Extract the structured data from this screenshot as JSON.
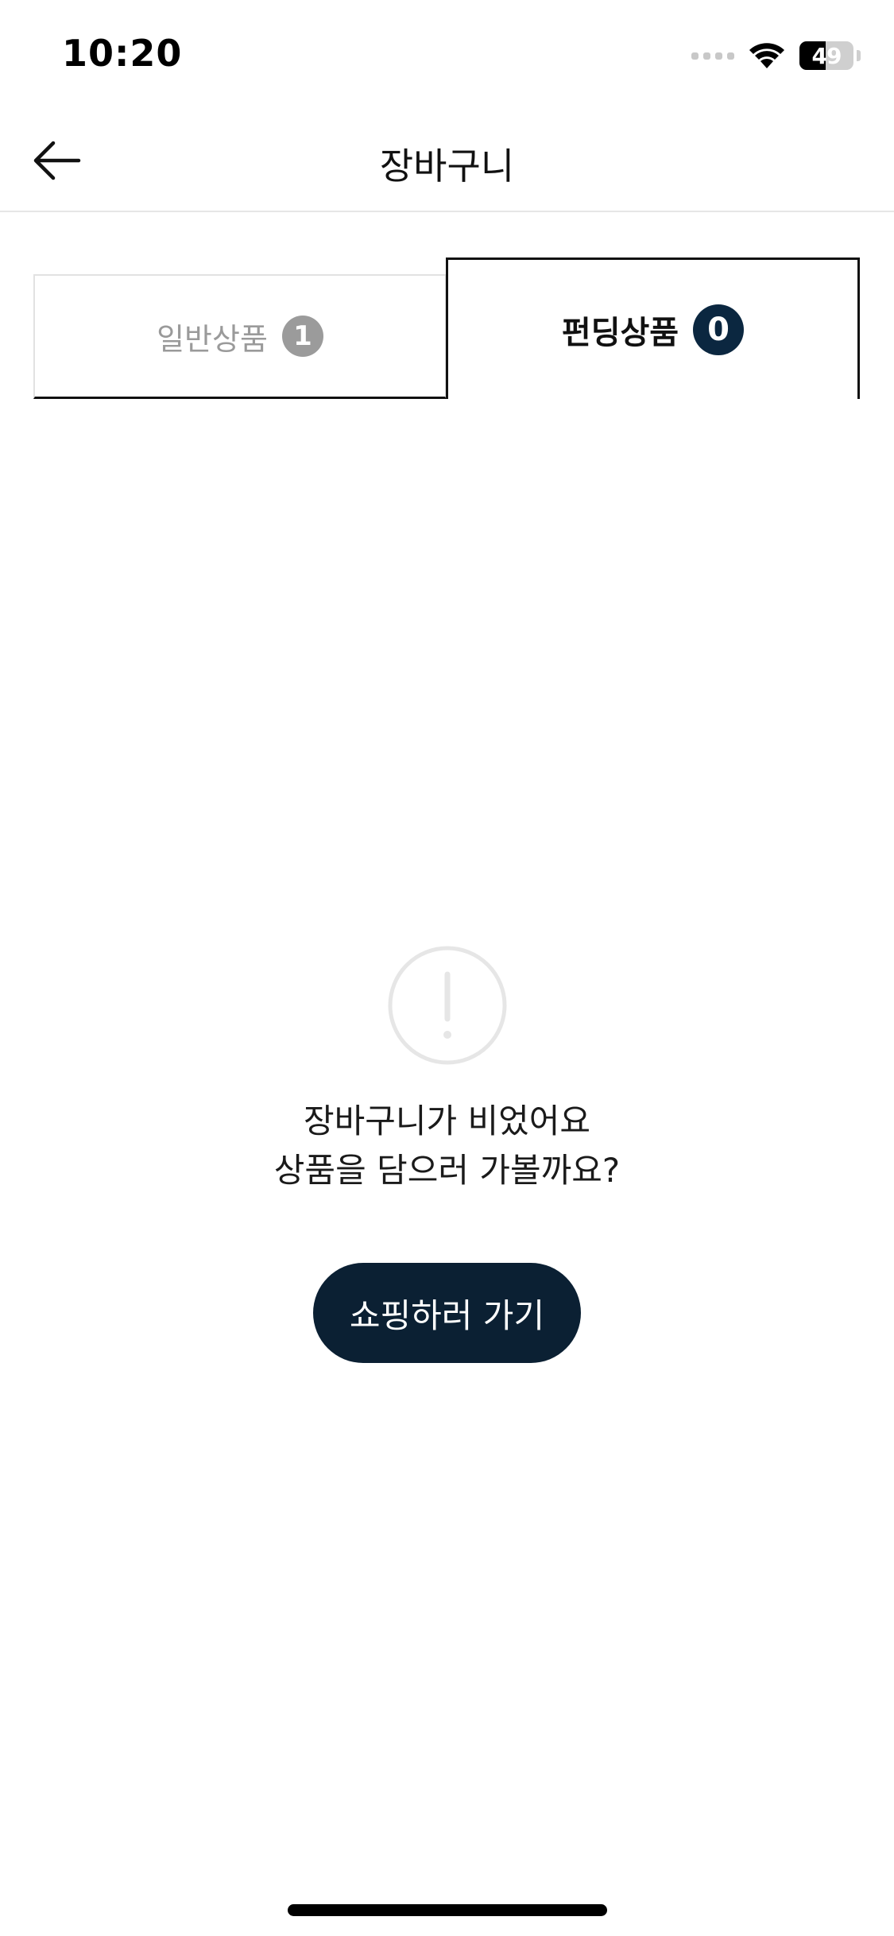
{
  "status_bar": {
    "time": "10:20",
    "battery_level": "49",
    "icons": [
      "signal-dots-icon",
      "wifi-icon",
      "battery-icon"
    ]
  },
  "header": {
    "title": "장바구니",
    "back_icon": "arrow-left-icon"
  },
  "tabs": [
    {
      "label": "일반상품",
      "count": "1",
      "selected": false
    },
    {
      "label": "펀딩상품",
      "count": "0",
      "selected": true
    }
  ],
  "empty_state": {
    "icon": "exclamation-circle-icon",
    "line1": "장바구니가 비었어요",
    "line2": "상품을 담으러 가볼까요?",
    "button_label": "쇼핑하러 가기"
  },
  "colors": {
    "accent": "#0b2033",
    "badge_active": "#0b2740",
    "badge_inactive": "#9b9b9b",
    "divider": "#e6e6e6"
  }
}
